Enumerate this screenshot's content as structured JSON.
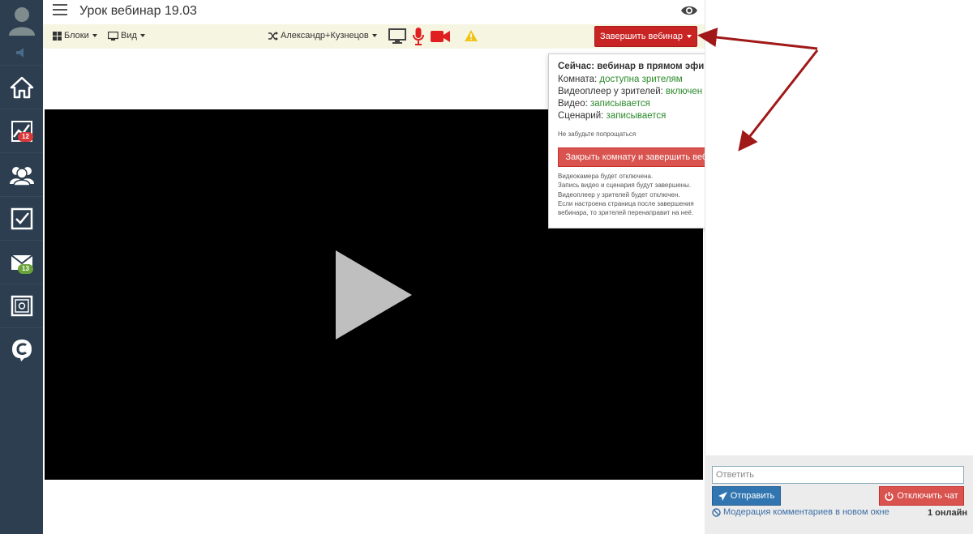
{
  "header": {
    "title": "Урок вебинар 19.03"
  },
  "toolbar": {
    "blocks_label": "Блоки",
    "view_label": "Вид",
    "user_label": "Александр+Кузнецов",
    "end_webinar_label": "Завершить вебинар"
  },
  "sidebar": {
    "badges": {
      "stats": "12",
      "mail": "13"
    }
  },
  "dropdown": {
    "heading": "Сейчас: вебинар в прямом эфире",
    "room_label": "Комната: ",
    "room_value": "доступна зрителям",
    "player_label": "Видеоплеер у зрителей: ",
    "player_value": "включен",
    "video_label": "Видео: ",
    "video_value": "записывается",
    "script_label": "Сценарий: ",
    "script_value": "записывается",
    "note": "Не забудьте попрощаться",
    "close_button": "Закрыть комнату и завершить вебинар",
    "info_lines": [
      "Видеокамера будет отключена.",
      "Запись видео и сценария будут завершены.",
      "Видеоплеер у зрителей будет отключен.",
      "Если настроена страница после завершения",
      "вебинара, то зрителей перенаправит на неё."
    ]
  },
  "chat": {
    "reply_placeholder": "Ответить",
    "send_label": "Отправить",
    "disable_chat_label": "Отключить чат",
    "moderation_label": "Модерация комментариев в новом окне",
    "online_count": "1 онлайн"
  },
  "colors": {
    "sidebar_bg": "#2c3e50",
    "toolbar_bg": "#f6f5e2",
    "end_button": "#c82424",
    "status_green": "#2a8a2a",
    "arrow": "#a01818"
  }
}
